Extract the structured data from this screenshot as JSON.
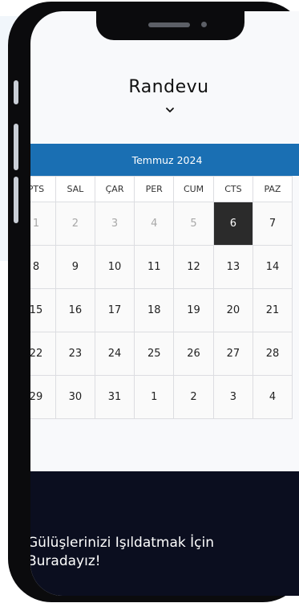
{
  "page": {
    "title": "Randevu"
  },
  "calendar": {
    "month_label": "Temmuz 2024",
    "weekdays": [
      "PTS",
      "SAL",
      "ÇAR",
      "PER",
      "CUM",
      "CTS",
      "PAZ"
    ],
    "weeks": [
      [
        "1",
        "2",
        "3",
        "4",
        "5",
        "6",
        "7"
      ],
      [
        "8",
        "9",
        "10",
        "11",
        "12",
        "13",
        "14"
      ],
      [
        "15",
        "16",
        "17",
        "18",
        "19",
        "20",
        "21"
      ],
      [
        "22",
        "23",
        "24",
        "25",
        "26",
        "27",
        "28"
      ],
      [
        "29",
        "30",
        "31",
        "1",
        "2",
        "3",
        "4"
      ]
    ],
    "selected_day": "6"
  },
  "banner": {
    "line1": "Gülüşlerinizi Işıldatmak İçin",
    "line2": "Buradayız!"
  },
  "colors": {
    "header": "#1a6fb3",
    "selected": "#2b2b2b",
    "banner": "#0b0e1f"
  },
  "icons": {
    "title_toggle": "chevron-down-icon"
  }
}
